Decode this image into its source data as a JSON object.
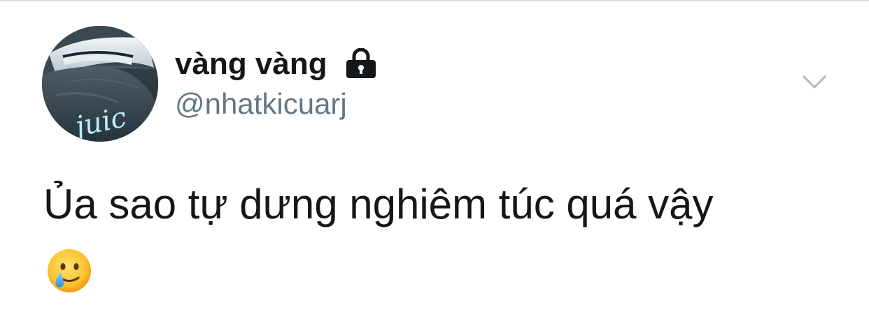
{
  "tweet": {
    "author": {
      "display_name": "vàng vàng",
      "handle": "@nhatkicuarj",
      "protected_icon": "lock-icon",
      "avatar_text": "juic"
    },
    "menu_icon": "chevron-down-icon",
    "text": "Ủa sao tự dưng nghiêm túc quá vậy",
    "emoji": "smiling-face-with-tear"
  },
  "colors": {
    "text_primary": "#14171a",
    "text_secondary": "#657786",
    "caret": "#aab8c2",
    "divider": "#d9dee2"
  }
}
